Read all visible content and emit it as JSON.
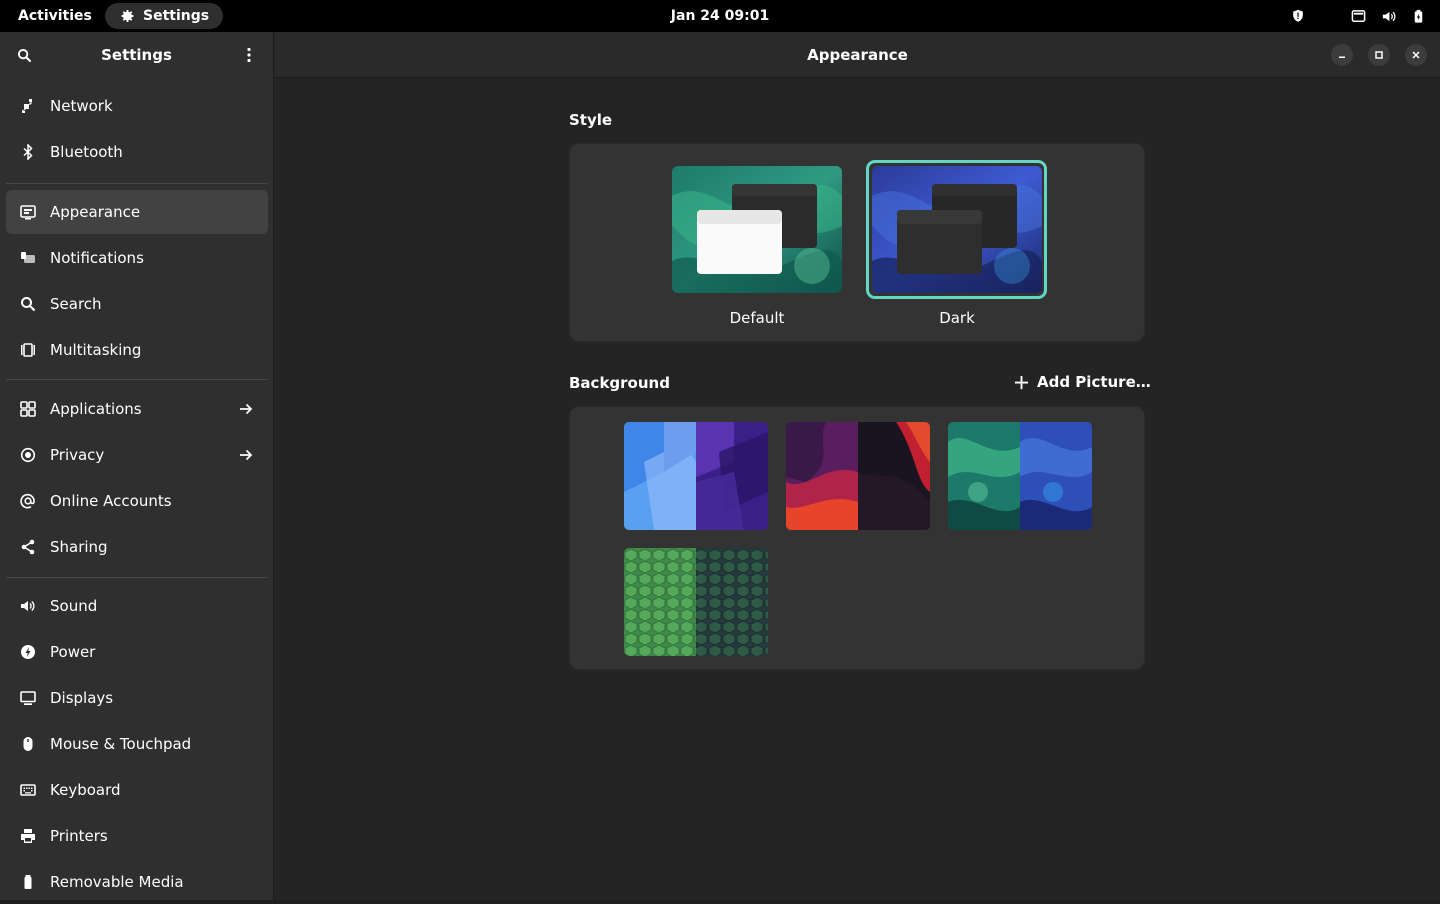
{
  "topbar": {
    "activities": "Activities",
    "app_menu": "Settings",
    "clock": "Jan 24  09:01",
    "tray_icons": [
      "shield-icon",
      "network-wired-icon",
      "volume-icon",
      "battery-icon"
    ]
  },
  "sidebar": {
    "title": "Settings",
    "items": [
      {
        "label": "Network",
        "icon": "network-icon"
      },
      {
        "label": "Bluetooth",
        "icon": "bluetooth-icon"
      },
      {
        "label": "Appearance",
        "icon": "appearance-icon",
        "active": true
      },
      {
        "label": "Notifications",
        "icon": "notifications-icon"
      },
      {
        "label": "Search",
        "icon": "search-icon"
      },
      {
        "label": "Multitasking",
        "icon": "multitasking-icon"
      },
      {
        "label": "Applications",
        "icon": "applications-icon",
        "arrow": true
      },
      {
        "label": "Privacy",
        "icon": "privacy-icon",
        "arrow": true
      },
      {
        "label": "Online Accounts",
        "icon": "online-accounts-icon"
      },
      {
        "label": "Sharing",
        "icon": "sharing-icon"
      },
      {
        "label": "Sound",
        "icon": "sound-icon"
      },
      {
        "label": "Power",
        "icon": "power-icon"
      },
      {
        "label": "Displays",
        "icon": "displays-icon"
      },
      {
        "label": "Mouse & Touchpad",
        "icon": "mouse-icon"
      },
      {
        "label": "Keyboard",
        "icon": "keyboard-icon"
      },
      {
        "label": "Printers",
        "icon": "printer-icon"
      },
      {
        "label": "Removable Media",
        "icon": "removable-media-icon"
      }
    ]
  },
  "main": {
    "title": "Appearance",
    "style": {
      "heading": "Style",
      "options": [
        {
          "label": "Default",
          "selected": false
        },
        {
          "label": "Dark",
          "selected": true
        }
      ]
    },
    "background": {
      "heading": "Background",
      "add_picture": "Add Picture…",
      "wallpapers": [
        "blue-purple-blocks",
        "red-dark-waves",
        "green-blue-swirl",
        "green-honeycomb"
      ]
    }
  },
  "colors": {
    "accent": "#61d7c4",
    "topbar": "#000000",
    "sidebar": "#2f2f2f",
    "content": "#242424",
    "card": "#333333",
    "active_item": "#424242"
  }
}
